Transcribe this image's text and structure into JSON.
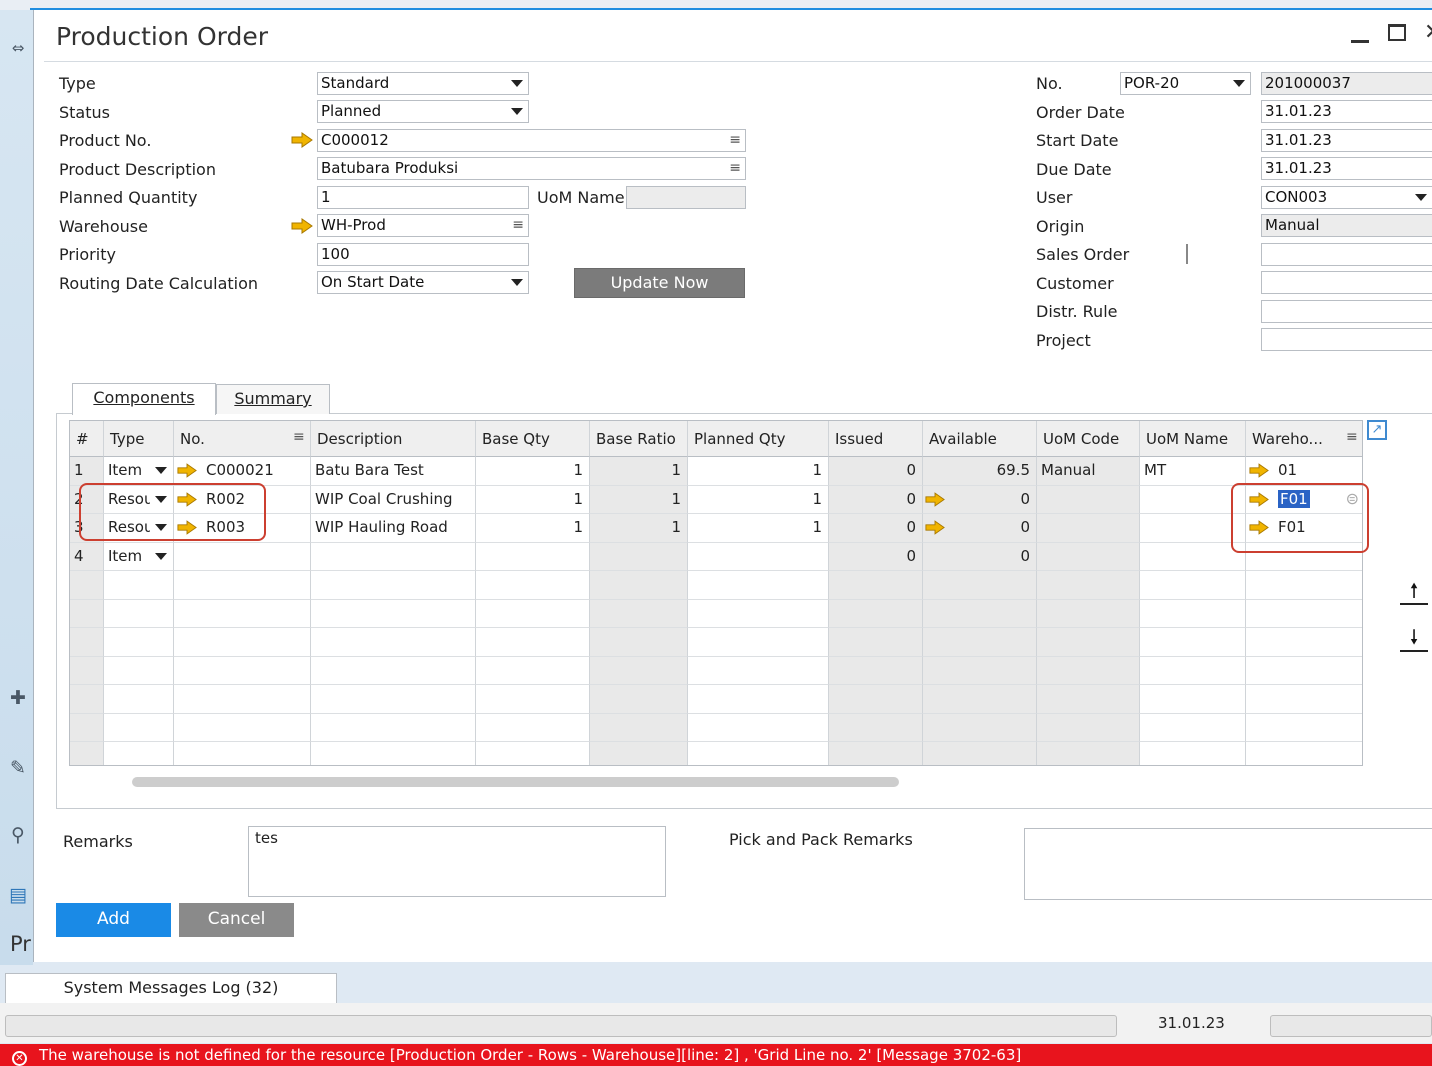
{
  "window": {
    "title": "Production Order"
  },
  "header_left": {
    "type": {
      "label": "Type",
      "value": "Standard"
    },
    "status": {
      "label": "Status",
      "value": "Planned"
    },
    "product_no": {
      "label": "Product No.",
      "value": "C000012"
    },
    "product_description": {
      "label": "Product Description",
      "value": "Batubara Produksi"
    },
    "planned_quantity": {
      "label": "Planned Quantity",
      "value": "1"
    },
    "uom_name": {
      "label": "UoM Name",
      "value": ""
    },
    "warehouse": {
      "label": "Warehouse",
      "value": "WH-Prod"
    },
    "priority": {
      "label": "Priority",
      "value": "100"
    },
    "routing_date_calculation": {
      "label": "Routing Date Calculation",
      "value": "On Start Date"
    },
    "update_now_label": "Update Now"
  },
  "header_right": {
    "no": {
      "label": "No.",
      "series": "POR-20",
      "value": "201000037"
    },
    "order_date": {
      "label": "Order Date",
      "value": "31.01.23"
    },
    "start_date": {
      "label": "Start Date",
      "value": "31.01.23"
    },
    "due_date": {
      "label": "Due Date",
      "value": "31.01.23"
    },
    "user": {
      "label": "User",
      "value": "CON003"
    },
    "origin": {
      "label": "Origin",
      "value": "Manual"
    },
    "sales_order": {
      "label": "Sales Order",
      "value": ""
    },
    "customer": {
      "label": "Customer",
      "value": ""
    },
    "distr_rule": {
      "label": "Distr. Rule",
      "value": ""
    },
    "project": {
      "label": "Project",
      "value": ""
    }
  },
  "tabs": [
    {
      "label": "Components",
      "active": true
    },
    {
      "label": "Summary",
      "active": false
    }
  ],
  "grid": {
    "columns": [
      "#",
      "Type",
      "No.",
      "Description",
      "Base Qty",
      "Base Ratio",
      "Planned Qty",
      "Issued",
      "Available",
      "UoM Code",
      "UoM Name",
      "Wareho..."
    ],
    "rows": [
      {
        "n": "1",
        "type": "Item",
        "no": "C000021",
        "description": "Batu Bara Test",
        "base_qty": "1",
        "base_ratio": "1",
        "planned_qty": "1",
        "issued": "0",
        "available": "69.5",
        "uom_code": "Manual",
        "uom_name": "MT",
        "warehouse": "01"
      },
      {
        "n": "2",
        "type": "Resource",
        "no": "R002",
        "description": "WIP Coal Crushing",
        "base_qty": "1",
        "base_ratio": "1",
        "planned_qty": "1",
        "issued": "0",
        "available": "0",
        "uom_code": "",
        "uom_name": "",
        "warehouse": "F01"
      },
      {
        "n": "3",
        "type": "Resource",
        "no": "R003",
        "description": "WIP Hauling Road",
        "base_qty": "1",
        "base_ratio": "1",
        "planned_qty": "1",
        "issued": "0",
        "available": "0",
        "uom_code": "",
        "uom_name": "",
        "warehouse": "F01"
      },
      {
        "n": "4",
        "type": "Item",
        "no": "",
        "description": "",
        "base_qty": "",
        "base_ratio": "",
        "planned_qty": "",
        "issued": "0",
        "available": "0",
        "uom_code": "",
        "uom_name": "",
        "warehouse": ""
      }
    ]
  },
  "remarks": {
    "label": "Remarks",
    "value": "tes"
  },
  "pick_pack_remarks": {
    "label": "Pick and Pack Remarks",
    "value": ""
  },
  "buttons": {
    "add": "Add",
    "cancel": "Cancel"
  },
  "status_bar": {
    "messages_log_label": "System Messages Log (32)",
    "date": "31.01.23",
    "error_message": "The warehouse is not defined for the resource [Production Order - Rows - Warehouse][line: 2] , 'Grid Line no. 2'  [Message 3702-63]"
  },
  "background_left_text": "Pr",
  "colors": {
    "accent": "#1a8ae6",
    "error": "#e8141d",
    "highlight": "#cc3f30",
    "link_arrow": "#f0b400"
  }
}
